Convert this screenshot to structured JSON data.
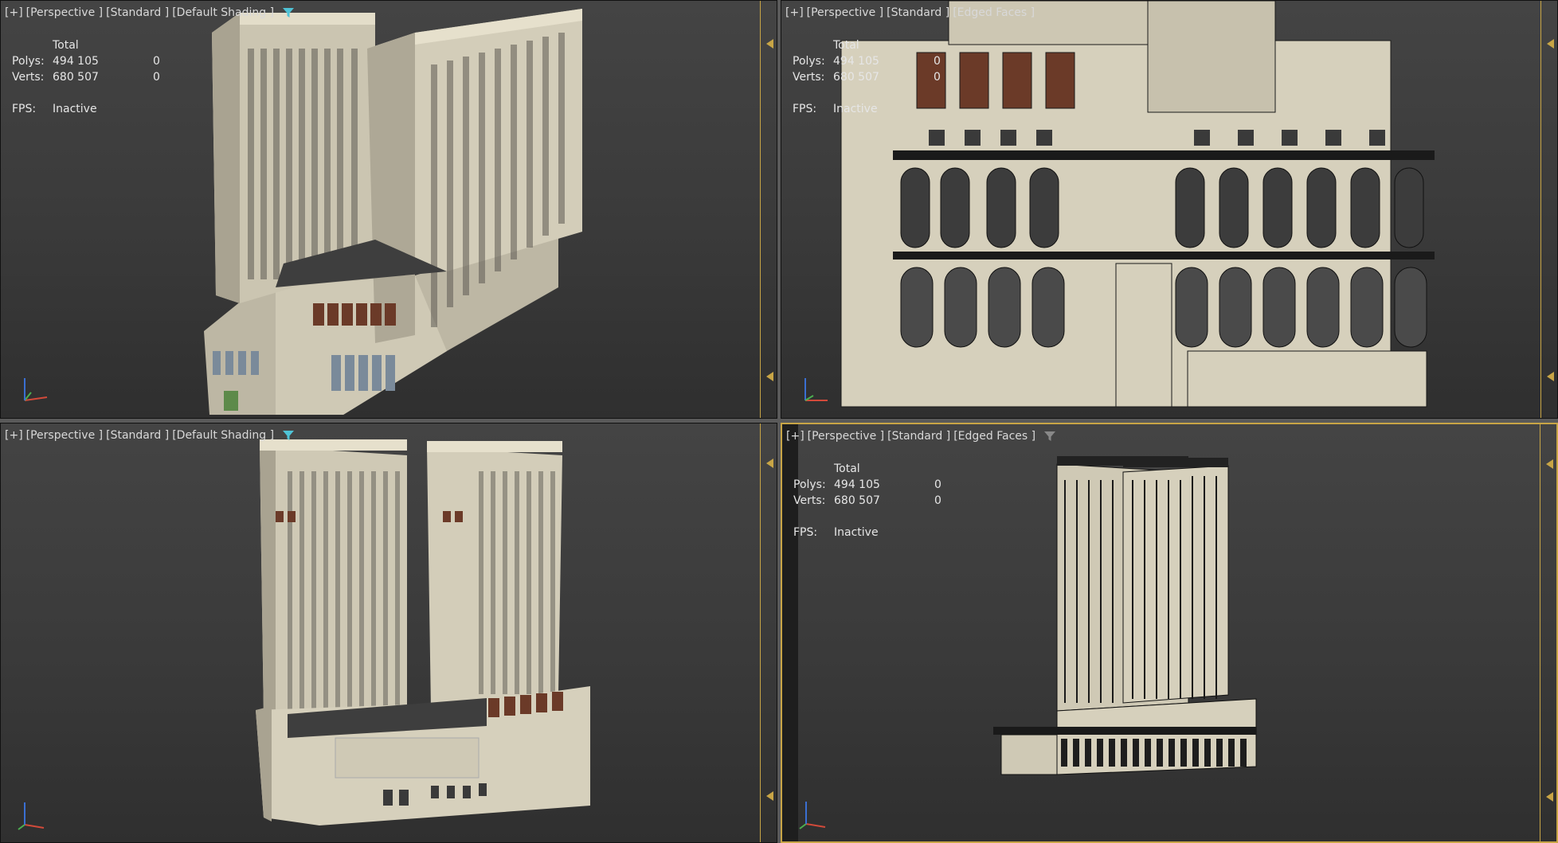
{
  "viewports": [
    {
      "header": {
        "plus": "[+]",
        "view": "[Perspective ]",
        "style": "[Standard ]",
        "shading": "[Default Shading ]"
      },
      "filter_color": "#4fc3d6"
    },
    {
      "header": {
        "plus": "[+]",
        "view": "[Perspective ]",
        "style": "[Standard ]",
        "shading": "[Edged Faces ]"
      },
      "filter_color": "#888888"
    },
    {
      "header": {
        "plus": "[+]",
        "view": "[Perspective ]",
        "style": "[Standard ]",
        "shading": "[Default Shading ]"
      },
      "filter_color": "#4fc3d6"
    },
    {
      "header": {
        "plus": "[+]",
        "view": "[Perspective ]",
        "style": "[Standard ]",
        "shading": "[Edged Faces ]"
      },
      "filter_color": "#888888"
    }
  ],
  "stats": {
    "total_label": "Total",
    "polys_label": "Polys:",
    "polys_value": "494 105",
    "polys_sel": "0",
    "verts_label": "Verts:",
    "verts_value": "680 507",
    "verts_sel": "0",
    "fps_label": "FPS:",
    "fps_value": "Inactive"
  },
  "colors": {
    "accent": "#c8a546",
    "building": "#d6d0bc",
    "building_shadow": "#a8a290",
    "window_dark": "#3a3a3a",
    "brown": "#6b3a28",
    "edge": "#1a1a1a"
  }
}
